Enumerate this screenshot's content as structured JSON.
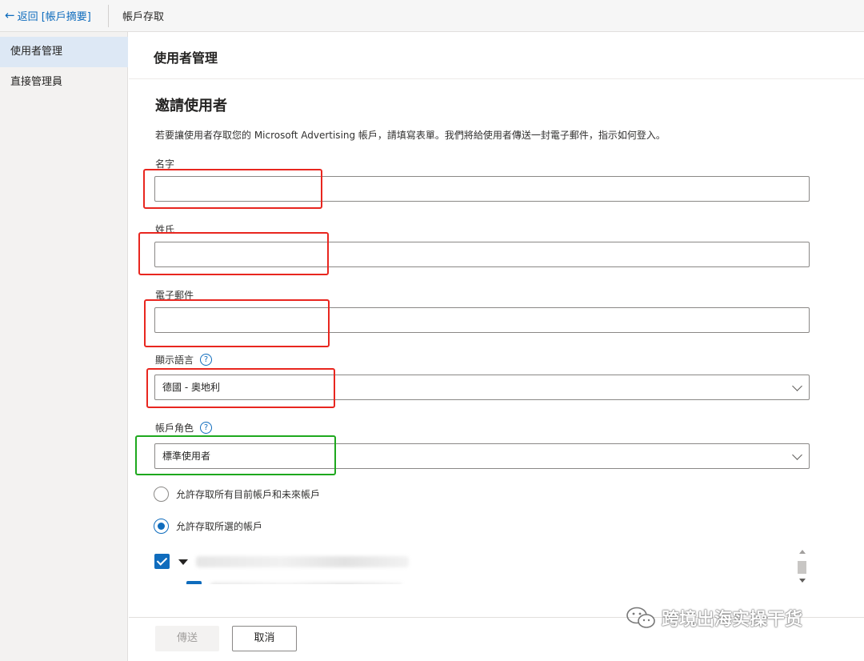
{
  "topbar": {
    "back_label": "返回 [帳戶摘要]",
    "title": "帳戶存取"
  },
  "sidebar": {
    "items": [
      {
        "label": "使用者管理",
        "active": true
      },
      {
        "label": "直接管理員",
        "active": false
      }
    ]
  },
  "main": {
    "section_title": "使用者管理",
    "form_title": "邀請使用者",
    "description": "若要讓使用者存取您的 Microsoft Advertising 帳戶，請填寫表單。我們將給使用者傳送一封電子郵件，指示如何登入。"
  },
  "form": {
    "first_name": {
      "label": "名字",
      "value": ""
    },
    "last_name": {
      "label": "姓氏",
      "value": ""
    },
    "email": {
      "label": "電子郵件",
      "value": ""
    },
    "language": {
      "label": "顯示語言",
      "value": "德國 - 奧地利"
    },
    "role": {
      "label": "帳戶角色",
      "value": "標準使用者"
    },
    "help_glyph": "?"
  },
  "access": {
    "option_all": "允許存取所有目前帳戶和未來帳戶",
    "option_selected": "允許存取所選的帳戶",
    "selected": "option_selected"
  },
  "footer": {
    "send_label": "傳送",
    "cancel_label": "取消"
  },
  "watermark": {
    "text": "跨境出海实操干货"
  },
  "colors": {
    "accent": "#0f6cbd",
    "highlight_red": "#e8261f",
    "highlight_green": "#1ea81e"
  }
}
